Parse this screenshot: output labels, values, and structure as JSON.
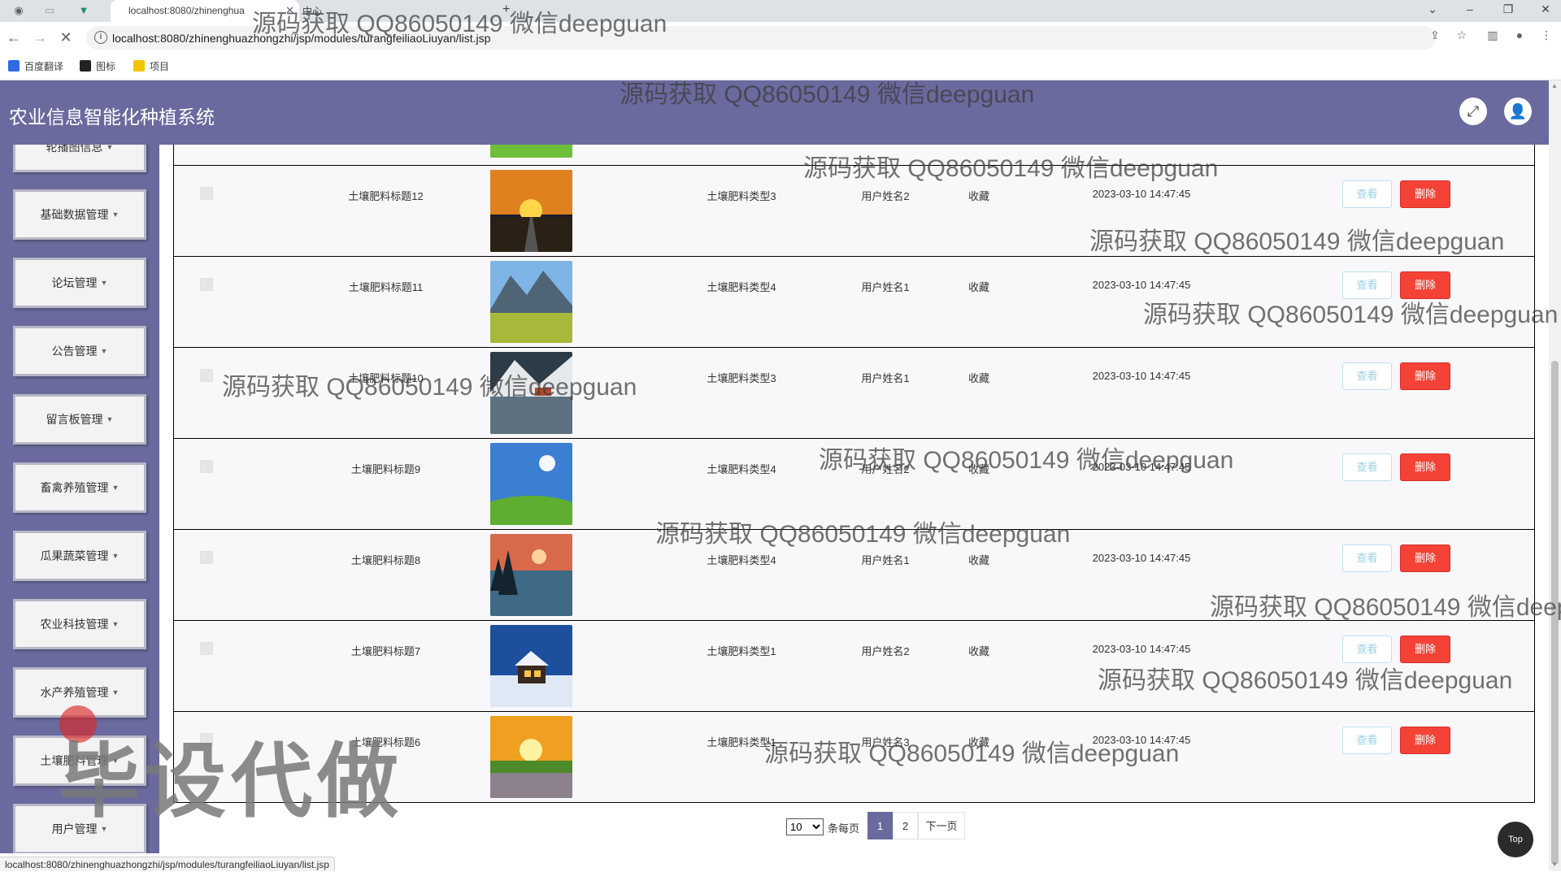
{
  "browser": {
    "tab_title": "localhost:8080/zhinenghua",
    "tab_2_title": "中心",
    "url": "localhost:8080/zhinenghuazhongzhi/jsp/modules/turangfeiliaoLiuyan/list.jsp",
    "status_url": "localhost:8080/zhinenghuazhongzhi/jsp/modules/turangfeiliaoLiuyan/list.jsp",
    "bookmarks": [
      {
        "label": "百度翻译",
        "color": "#2e6ce6"
      },
      {
        "label": "图标",
        "color": "#222222"
      },
      {
        "label": "项目",
        "color": "#f2c400"
      }
    ]
  },
  "app": {
    "title": "农业信息智能化种植系统",
    "header_color": "#6a6a9e"
  },
  "sidebar": {
    "items": [
      {
        "label": "轮播图信息"
      },
      {
        "label": "基础数据管理"
      },
      {
        "label": "论坛管理"
      },
      {
        "label": "公告管理"
      },
      {
        "label": "留言板管理"
      },
      {
        "label": "畜禽养殖管理"
      },
      {
        "label": "瓜果蔬菜管理"
      },
      {
        "label": "农业科技管理"
      },
      {
        "label": "水产养殖管理"
      },
      {
        "label": "土壤肥料管理"
      },
      {
        "label": "用户管理"
      }
    ]
  },
  "table": {
    "view_label": "查看",
    "delete_label": "删除",
    "rows": [
      {
        "title": "土壤肥料标题12",
        "type": "土壤肥料类型3",
        "user": "用户姓名2",
        "action": "收藏",
        "time": "2023-03-10 14:47:45",
        "image": "sunset-road"
      },
      {
        "title": "土壤肥料标题11",
        "type": "土壤肥料类型4",
        "user": "用户姓名1",
        "action": "收藏",
        "time": "2023-03-10 14:47:45",
        "image": "mountain-meadow"
      },
      {
        "title": "土壤肥料标题10",
        "type": "土壤肥料类型3",
        "user": "用户姓名1",
        "action": "收藏",
        "time": "2023-03-10 14:47:45",
        "image": "lake-village"
      },
      {
        "title": "土壤肥料标题9",
        "type": "土壤肥料类型4",
        "user": "用户姓名2",
        "action": "收藏",
        "time": "2023-03-10 14:47:45",
        "image": "green-hill-sky"
      },
      {
        "title": "土壤肥料标题8",
        "type": "土壤肥料类型4",
        "user": "用户姓名1",
        "action": "收藏",
        "time": "2023-03-10 14:47:45",
        "image": "moon-lake"
      },
      {
        "title": "土壤肥料标题7",
        "type": "土壤肥料类型1",
        "user": "用户姓名2",
        "action": "收藏",
        "time": "2023-03-10 14:47:45",
        "image": "snow-cabin"
      },
      {
        "title": "土壤肥料标题6",
        "type": "土壤肥料类型1",
        "user": "用户姓名3",
        "action": "收藏",
        "time": "2023-03-10 14:47:45",
        "image": "sunset-flowers"
      }
    ]
  },
  "pagination": {
    "page_size": "10",
    "per_page_label": "条每页",
    "pages": [
      "1",
      "2"
    ],
    "current": "1",
    "next_label": "下一页"
  },
  "top_button": "Top",
  "watermark": {
    "text": "源码获取 QQ86050149 微信deepguan",
    "big_text": "毕设代做"
  }
}
